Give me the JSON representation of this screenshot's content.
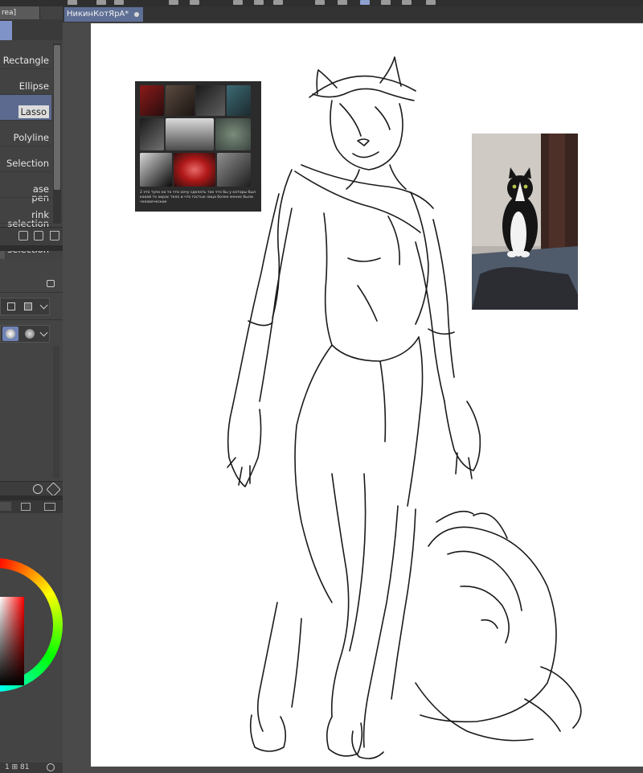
{
  "left_panel": {
    "sub_tool_tab": "rea]",
    "tools": [
      {
        "label": "Rectangle",
        "active": false
      },
      {
        "label": "Ellipse",
        "active": false
      },
      {
        "label": "Lasso",
        "active": true
      },
      {
        "label": "Polyline",
        "active": false
      },
      {
        "label": "Selection pen",
        "active": false
      },
      {
        "label": "ase selection",
        "active": false
      },
      {
        "label": "rink selection",
        "active": false
      }
    ],
    "status": "1 ⊞ 81"
  },
  "document": {
    "tab_title": "НикинКотЯрА*"
  },
  "reference_board": {
    "caption": "2 это тупо на то что хочу сделать так что бы у которы был какой то окрас тела и что гостые лица более менее были человеческие"
  },
  "icons": [
    "save-icon",
    "add-layer-icon",
    "trash-icon",
    "lock-icon",
    "settings-wrench-icon",
    "gauge-icon"
  ]
}
